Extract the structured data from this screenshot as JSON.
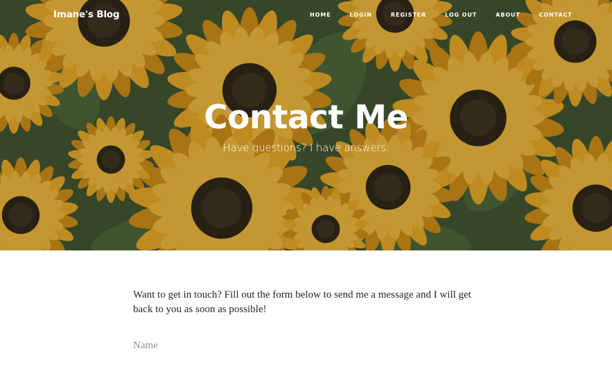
{
  "brand": {
    "name": "Imane's Blog"
  },
  "nav": {
    "items": [
      "HOME",
      "LOGIN",
      "REGISTER",
      "LOG OUT",
      "ABOUT",
      "CONTACT"
    ]
  },
  "hero": {
    "title": "Contact Me",
    "subtitle": "Have questions? I have answers.",
    "background": "sunflowers-photo"
  },
  "content": {
    "intro": "Want to get in touch? Fill out the form below to send me a message and I will get back to you as soon as possible!"
  },
  "form": {
    "name_placeholder": "Name"
  },
  "colors": {
    "petal": "#e3a726",
    "petal_dark": "#c98a16",
    "center": "#2b2415",
    "foliage": "#3c5230",
    "text": "#212529",
    "placeholder": "#868e96"
  }
}
